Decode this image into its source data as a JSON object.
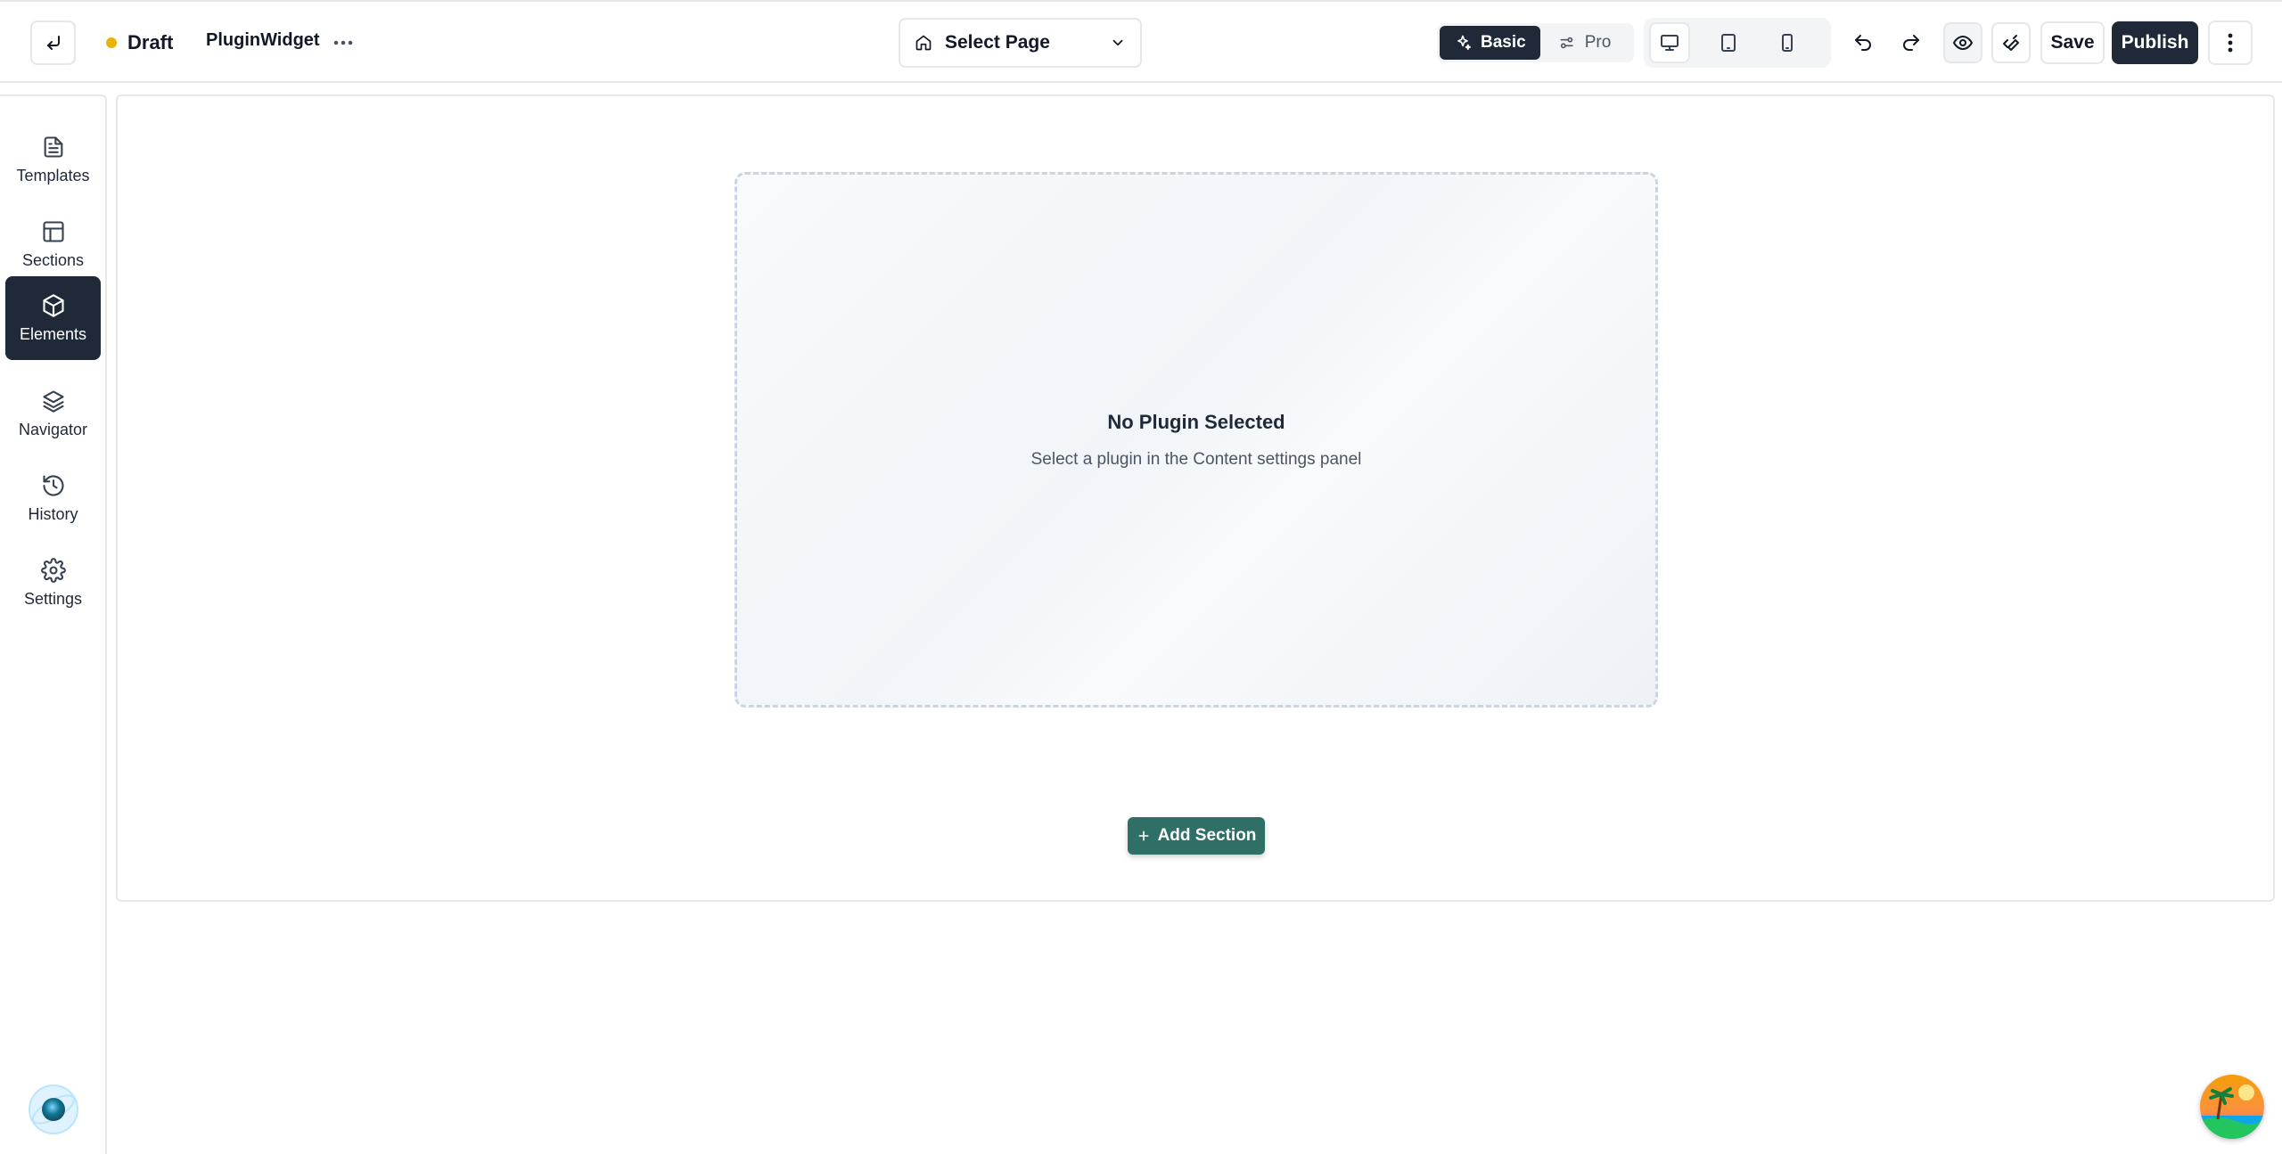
{
  "header": {
    "status": "Draft",
    "project_name": "PluginWidget",
    "page_select": "Select Page",
    "modes": [
      {
        "label": "Basic",
        "active": true
      },
      {
        "label": "Pro",
        "active": false
      }
    ],
    "devices": [
      "desktop-icon",
      "tablet-icon",
      "mobile-icon"
    ],
    "save_label": "Save",
    "publish_label": "Publish"
  },
  "sidebar": {
    "items": [
      {
        "label": "Templates",
        "icon": "file-text-icon",
        "active": false
      },
      {
        "label": "Sections",
        "icon": "layout-icon",
        "active": false
      },
      {
        "label": "Elements",
        "icon": "box-icon",
        "active": true
      },
      {
        "label": "Navigator",
        "icon": "layers-icon",
        "active": false
      },
      {
        "label": "History",
        "icon": "history-icon",
        "active": false
      },
      {
        "label": "Settings",
        "icon": "gear-icon",
        "active": false
      }
    ]
  },
  "canvas": {
    "placeholder_title": "No Plugin Selected",
    "placeholder_subtitle": "Select a plugin in the Content settings panel",
    "add_section_label": "Add Section"
  },
  "colors": {
    "accent_dark": "#1f2937",
    "status_draft": "#eab308",
    "add_section": "#2f6f66",
    "border": "#e5e7eb"
  }
}
